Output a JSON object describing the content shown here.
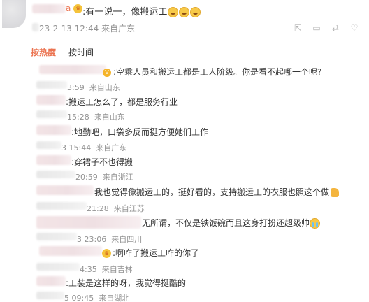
{
  "header": {
    "username_tail": "a",
    "comment_text": ":有一说一，像搬运工",
    "timestamp": "23-2-13 12:44",
    "location": "来自广东"
  },
  "icons": [
    "share-icon",
    "comment-icon",
    "repost-icon",
    "like-icon"
  ],
  "tabs": [
    {
      "label": "按热度"
    },
    {
      "label": "按时间"
    }
  ],
  "comments": [
    {
      "text": ":空乘人员和搬运工都是工人阶级。你是看不起哪一个呢?",
      "time": "3:59",
      "location": "来自山东"
    },
    {
      "text": ":搬运工怎么了，都是服务行业",
      "time": "15:28",
      "location": "来自山东"
    },
    {
      "text": ":地勤吧，口袋多反而挺方便她们工作",
      "time": "3 15:44",
      "location": "来自广东"
    },
    {
      "text": ":穿裙子不也得搬",
      "time": "20:59",
      "location": "来自浙江"
    },
    {
      "text": "我也觉得像搬运工的，挺好看的，支持搬运工的衣服也照这个做",
      "time": "21:28",
      "location": "来自江苏"
    },
    {
      "text": "无所谓，不仅是铁饭碗而且这身打扮还超级帅",
      "time": "3 23:06",
      "location": "来自四川"
    },
    {
      "text": ":啊咋了搬运工咋的你了",
      "time": "4:35",
      "location": "来自吉林"
    },
    {
      "text": ":工装是这样的呀，我觉得挺酷的",
      "time": "5 09:45",
      "location": "来自湖北"
    }
  ]
}
